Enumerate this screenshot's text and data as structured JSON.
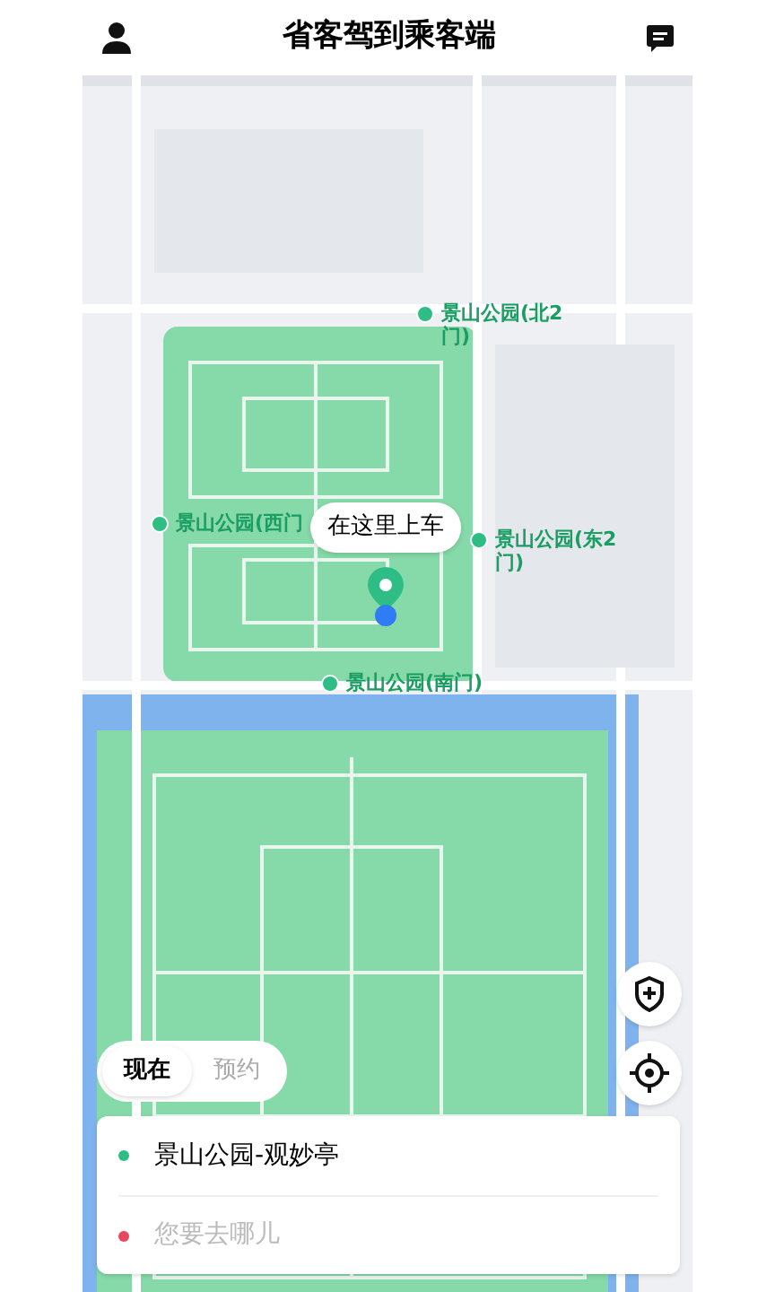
{
  "header": {
    "title": "省客驾到乘客端"
  },
  "map": {
    "pins": [
      {
        "label": "景山公园(北2门)"
      },
      {
        "label": "景山公园(西门"
      },
      {
        "label": "景山公园(东2门)"
      },
      {
        "label": "景山公园(南门)"
      }
    ],
    "pickup_bubble": "在这里上车"
  },
  "ride_tabs": [
    {
      "label": "现在",
      "selected": true
    },
    {
      "label": "预约",
      "selected": false
    }
  ],
  "route": [
    {
      "kind": "origin",
      "text": "景山公园-观妙亭",
      "color": "#2ebd85"
    },
    {
      "kind": "destination",
      "placeholder": "您要去哪儿",
      "color": "#e8485c"
    }
  ]
}
